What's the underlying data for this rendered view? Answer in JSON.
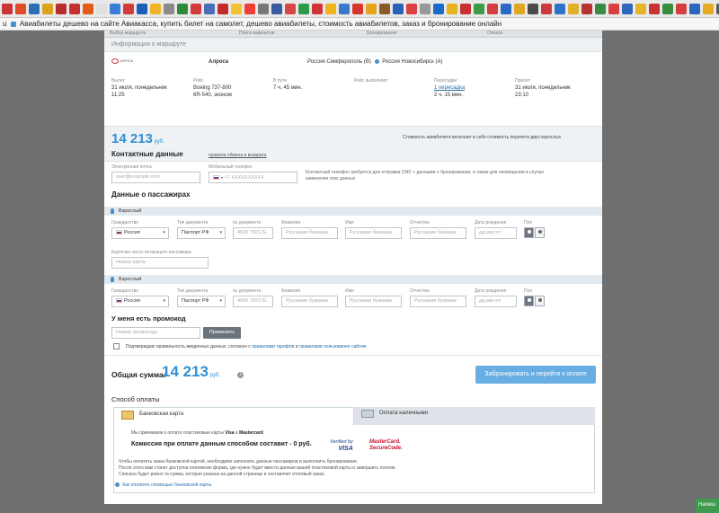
{
  "browser": {
    "bookmark_colors": [
      "#cc3333",
      "#e04b2a",
      "#2c6fb6",
      "#d9a31b",
      "#b82d2d",
      "#c43030",
      "#e35b1b",
      "#e0e0e0",
      "#3b7dd8",
      "#d43c3c",
      "#1c5db6",
      "#f0b429",
      "#8a8a8a",
      "#2d8a3c",
      "#d13b3b",
      "#4b6cb7",
      "#c52a2a",
      "#f2c230",
      "#ee4036",
      "#777777",
      "#3a5ba0",
      "#d94545",
      "#2d9a4a",
      "#cf3535",
      "#efb320",
      "#3c78c8",
      "#d8362a",
      "#e7a31a",
      "#8a5a2b",
      "#2962b9",
      "#dd4040",
      "#999999",
      "#1b6ac9",
      "#e6b422",
      "#c93030",
      "#3f9a47",
      "#d43f3f",
      "#2b6bc6",
      "#e0a820",
      "#4a4a4a",
      "#cc3b3b",
      "#2f74c8",
      "#e2b02c",
      "#b83232",
      "#3a8a44",
      "#d94040",
      "#2d68bd",
      "#e4b52a",
      "#c73434",
      "#388e3c",
      "#d33e3e",
      "#2c66ba",
      "#e3ac24",
      "#5a5a5a",
      "#c43737",
      "#3b7ccb",
      "#e1ad2d",
      "#b72f2f",
      "#3f8c45",
      "#d53b3b"
    ],
    "tab_title": "Авиабилеты дешево на сайте Авиакасса, купить билет на самолет, дешево авиабилеты, стоимость авиабилетов, заказ и бронирование онлайн",
    "tab_prefix": "u"
  },
  "steps": [
    "Выбор маршрута",
    "Поиск вариантов",
    "Бронирование",
    "Оплата"
  ],
  "route": {
    "section_title": "Информация о маршруте",
    "airline": "Алроса",
    "airline_logo_text": "АЛРОСА",
    "path_from": "Россия Симферополь (В)",
    "path_to": "Россия Новосибирск (А)",
    "departure_label": "Вылет",
    "departure_date": "31 июля, понедельник",
    "departure_time": "11:25",
    "flight_label": "Рейс",
    "aircraft": "Boeing 737-800",
    "flight_number": "6R-540, эконом",
    "duration_label": "В пути",
    "duration": "7 ч. 45 мин.",
    "operator_label": "Рейс выполняет",
    "transfers_label": "Пересадки",
    "transfers": "1 пересадка",
    "transfer_time": "2 ч. 15 мин.",
    "arrival_label": "Прилет",
    "arrival_date": "31 июля, понедельник",
    "arrival_time": "23:10"
  },
  "price": {
    "amount": "14 213",
    "currency": "руб.",
    "note": "Стоимость авиабилета включает в себя стоимость перелета двух взрослых",
    "rules_link": "правила обмена и возврата"
  },
  "contacts": {
    "title": "Контактные данные",
    "email_label": "Электронная почта",
    "email_placeholder": "user@example.com",
    "phone_label": "Мобильный телефон",
    "phone_placeholder": "+7 XXXXXXXXXX",
    "phone_note": "Контактный телефон требуется для отправки СМС с данными о бронировании, а также для оповещения в случае изменения этих данных"
  },
  "passengers": {
    "title": "Данные о пассажирах",
    "band_label": "Взрослый",
    "citizenship_label": "Гражданство",
    "citizenship_value": "Россия",
    "doctype_label": "Тип документа",
    "doctype_value": "Паспорт РФ",
    "docnum_label": "№ документа",
    "docnum_placeholder": "4506 78217Е",
    "surname_label": "Фамилия",
    "surname_placeholder": "Русскими буквами",
    "name_label": "Имя",
    "name_placeholder": "Русскими буквами",
    "patronymic_label": "Отчество",
    "patronymic_placeholder": "Русскими буквами",
    "birth_label": "Дата рождения",
    "birth_placeholder": "дд.мм.гггг",
    "gender_label": "Пол",
    "ffp_label": "Карточка часто летающего пассажира",
    "ffp_placeholder": "Номер карты"
  },
  "promo": {
    "title": "У меня есть промокод",
    "placeholder": "Номер промокода",
    "apply": "Применить"
  },
  "agree": {
    "text_before": "Подтверждаю правильность введенных данных, согласен с",
    "tariff_link": "правилами тарифов",
    "and": "и",
    "site_link": "правилами пользования сайтом"
  },
  "total": {
    "label": "Общая сумма:",
    "amount": "14 213",
    "currency": "руб.",
    "info_icon": "i",
    "book_button": "Забронировать и перейти к оплате"
  },
  "payment": {
    "title": "Способ оплаты",
    "tab_card": "Банковская карта",
    "tab_cash": "Оплата наличными",
    "accept_before": "Мы принимаем к оплате пластиковые карты",
    "visa": "Visa",
    "accept_and": "и",
    "mastercard": "Mastercard",
    "commission": "Комиссия при оплате данным способом составит - 0 руб.",
    "verified_line1": "Verified by",
    "verified_line2": "VISA",
    "mc_line1": "MasterCard.",
    "mc_line2": "SecureCode.",
    "info_line1": "Чтобы оплатить заказ банковской картой, необходимо заполнить данные пассажиров и выполнить бронирование.",
    "info_line2": "После этого вам станет доступна платежная форма, где нужно будет ввести данные вашей пластиковой карты и завершить платеж.",
    "info_line3": "Списана будет ровно та сумма, которая указана на данной странице и составляет итоговый заказ.",
    "how_link": "Как оплатить спомощью банковской карты"
  },
  "side_button": "Напиш"
}
